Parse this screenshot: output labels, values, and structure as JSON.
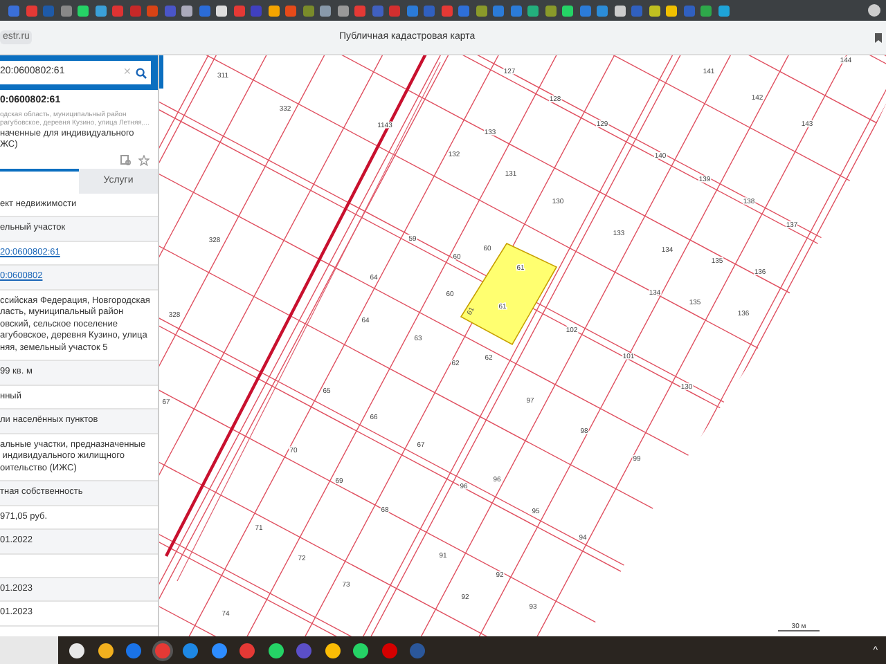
{
  "browser": {
    "address": "estr.ru",
    "title": "Публичная кадастровая карта"
  },
  "search": {
    "value": "20:0600802:61",
    "clear_glyph": "✕"
  },
  "tray": {
    "chevron": "^"
  },
  "object": {
    "title": "0:0600802:61",
    "address": "одская область, муниципальный район\nрагубовское, деревня Кузино, улица Летняя,...",
    "purpose": "наченные для индивидуального\nЖС)"
  },
  "tabs": [
    {
      "selected": true
    },
    {
      "label": "Услуги",
      "selected": false
    }
  ],
  "rows": [
    {
      "kind": "text",
      "value": "ект недвижимости"
    },
    {
      "kind": "text",
      "value": "ельный участок"
    },
    {
      "kind": "link",
      "value": "20:0600802:61"
    },
    {
      "kind": "link",
      "value": "0:0600802"
    },
    {
      "kind": "text",
      "value": "ссийская Федерация, Новгородская\nласть, муниципальный район\nовский, сельское поселение\nагубовское, деревня Кузино, улица\nняя, земельный участок 5"
    },
    {
      "kind": "text",
      "value": "99 кв. м"
    },
    {
      "kind": "text",
      "value": "нный"
    },
    {
      "kind": "text",
      "value": "ли населённых пунктов"
    },
    {
      "kind": "text",
      "value": "альные участки, предназначенные\n индивидуального жилищного\nоительство (ИЖС)"
    },
    {
      "kind": "text",
      "value": "тная собственность"
    },
    {
      "kind": "text",
      "value": "971,05 руб."
    },
    {
      "kind": "text",
      "value": "01.2022"
    },
    {
      "kind": "empty"
    },
    {
      "kind": "text",
      "value": "01.2023"
    },
    {
      "kind": "text",
      "value": "01.2023"
    }
  ],
  "map": {
    "parcels": [
      "311",
      "332",
      "1143",
      "127",
      "128",
      "141",
      "142",
      "143",
      "144",
      "133",
      "132",
      "129",
      "131",
      "140",
      "139",
      "138",
      "137",
      "328",
      "130",
      "133",
      "134",
      "135",
      "136",
      "59",
      "60",
      "60",
      "61",
      "64",
      "60",
      "61",
      "134",
      "135",
      "136",
      "328",
      "64",
      "63",
      "102",
      "101",
      "62",
      "62",
      "130",
      "65",
      "97",
      "67",
      "66",
      "98",
      "70",
      "67",
      "99",
      "69",
      "96",
      "96",
      "95",
      "68",
      "71",
      "94",
      "72",
      "91",
      "92",
      "73",
      "92",
      "93",
      "74"
    ],
    "selected_parcel": {
      "label": "61",
      "selected": true
    },
    "scale": "30 м"
  }
}
